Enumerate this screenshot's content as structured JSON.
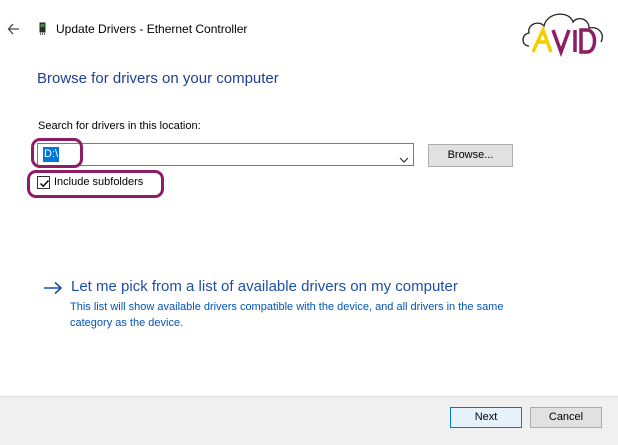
{
  "window": {
    "title": "Update Drivers - Ethernet Controller",
    "back_icon": "back-arrow-icon",
    "device_icon": "network-adapter-icon"
  },
  "logo": {
    "text": "AVID"
  },
  "main": {
    "heading": "Browse for drivers on your computer",
    "search_label": "Search for drivers in this location:",
    "path_value": "D:\\",
    "browse_label": "Browse...",
    "include_subfolders_label": "Include subfolders",
    "include_subfolders_checked": true,
    "pick_title": "Let me pick from a list of available drivers on my computer",
    "pick_description": "This list will show available drivers compatible with the device, and all drivers in the same category as the device."
  },
  "footer": {
    "next_label": "Next",
    "cancel_label": "Cancel"
  },
  "colors": {
    "heading": "#1e3f96",
    "link": "#1e4fa8",
    "selection": "#0078d7",
    "highlight_ring": "#8e1d64"
  }
}
